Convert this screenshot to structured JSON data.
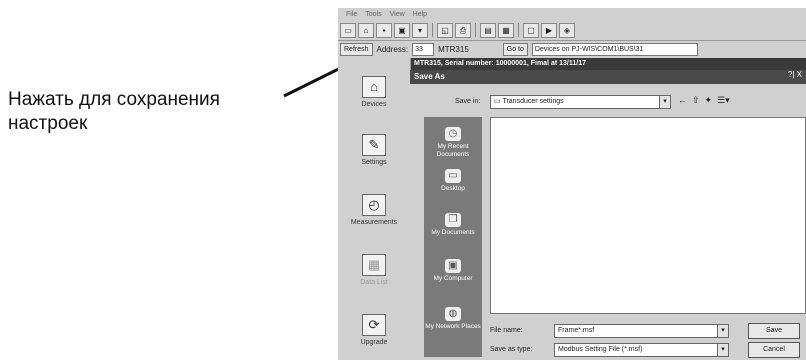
{
  "annotation": {
    "line1": "Нажать для сохранения",
    "line2": "настроек"
  },
  "window": {
    "menu": [
      "File",
      "Tools",
      "View",
      "Help"
    ],
    "toolbar_icons": [
      "new-icon",
      "open-icon",
      "save-icon",
      "save-as-icon",
      "print-preview-icon",
      "print-icon",
      "copy-icon",
      "paste-icon",
      "window-icon",
      "settings-icon",
      "help-icon"
    ],
    "refresh_label": "Refresh",
    "address_label": "Address:",
    "address_value": "33",
    "device_label": "MTR315",
    "goto_label": "Go to",
    "goto_value": "Devices on PJ-WIS\\COM1\\BUS\\31",
    "header_title": "MTR315, Serial number: 10000001, Fimal at 13/11/17"
  },
  "sidebar": {
    "items": [
      {
        "label": "Devices",
        "icon": "devices-icon"
      },
      {
        "label": "Settings",
        "icon": "settings-icon"
      },
      {
        "label": "Measurements",
        "icon": "measurements-icon"
      },
      {
        "label": "Data List",
        "icon": "datalist-icon"
      },
      {
        "label": "Upgrade",
        "icon": "upgrade-icon"
      }
    ]
  },
  "dialog": {
    "title": "Save As",
    "help": "?| X",
    "save_in_label": "Save in:",
    "save_in_value": "Transducer settings",
    "places": [
      {
        "label": "My Recent Documents",
        "icon": "recent-icon"
      },
      {
        "label": "Desktop",
        "icon": "desktop-icon"
      },
      {
        "label": "My Documents",
        "icon": "documents-icon"
      },
      {
        "label": "My Computer",
        "icon": "computer-icon"
      },
      {
        "label": "My Network Places",
        "icon": "network-icon"
      }
    ],
    "file_name_label": "File name:",
    "file_name_value": "Frame*.msf",
    "save_type_label": "Save as type:",
    "save_type_value": "Modbus Setting File (*.msf)",
    "save_button": "Save",
    "cancel_button": "Cancel"
  }
}
